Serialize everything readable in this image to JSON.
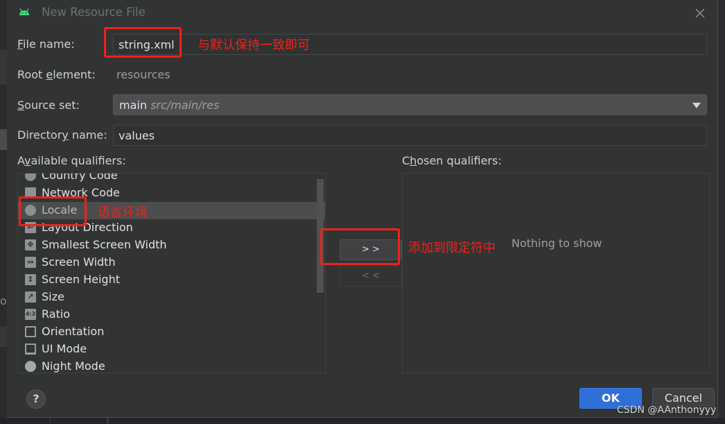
{
  "dialog": {
    "title": "New Resource File",
    "icons": {
      "app": "android-icon",
      "close": "close-icon",
      "help": "help-icon"
    }
  },
  "form": {
    "file_name": {
      "label_mnemonic": "F",
      "label_rest": "ile name:",
      "value": "string.xml"
    },
    "root_element": {
      "label_pre": "Root ",
      "label_mnemonic": "e",
      "label_rest": "lement:",
      "value": "resources"
    },
    "source_set": {
      "label_mnemonic": "S",
      "label_rest": "ource set:",
      "value": "main",
      "hint": "src/main/res"
    },
    "directory_name": {
      "label_pre": "Director",
      "label_mnemonic": "y",
      "label_rest": " name:",
      "value": "values"
    }
  },
  "available_qualifiers": {
    "label_pre": "A",
    "label_mnemonic": "v",
    "label_rest": "ailable qualifiers:",
    "items": [
      {
        "label": "Country Code",
        "icon": "country-code-icon"
      },
      {
        "label": "Network Code",
        "icon": "network-code-icon"
      },
      {
        "label": "Locale",
        "icon": "globe-icon",
        "selected": true
      },
      {
        "label": "Layout Direction",
        "icon": "layout-direction-icon"
      },
      {
        "label": "Smallest Screen Width",
        "icon": "move-arrows-icon"
      },
      {
        "label": "Screen Width",
        "icon": "horizontal-arrows-icon"
      },
      {
        "label": "Screen Height",
        "icon": "vertical-arrows-icon"
      },
      {
        "label": "Size",
        "icon": "resize-icon"
      },
      {
        "label": "Ratio",
        "icon": "ratio-icon"
      },
      {
        "label": "Orientation",
        "icon": "orientation-icon"
      },
      {
        "label": "UI Mode",
        "icon": "ui-mode-icon"
      },
      {
        "label": "Night Mode",
        "icon": "night-mode-icon"
      }
    ]
  },
  "transfer": {
    "add_label": "> >",
    "remove_label": "< <"
  },
  "chosen_qualifiers": {
    "label_pre": "C",
    "label_mnemonic": "h",
    "label_rest": "osen qualifiers:",
    "empty_text": "Nothing to show"
  },
  "buttons": {
    "help": "?",
    "ok": "OK",
    "cancel": "Cancel"
  },
  "annotations": {
    "file_name_note": "与默认保持一致即可",
    "locale_note": "语言环境",
    "add_note": "添加到限定符中",
    "color": "#f0221b"
  },
  "background": {
    "partial_text": "op"
  },
  "watermark": "CSDN @AAnthonyyy",
  "colors": {
    "accent": "#2f6fd8",
    "dialog_bg": "#323433",
    "android_green": "#3ddc84"
  }
}
